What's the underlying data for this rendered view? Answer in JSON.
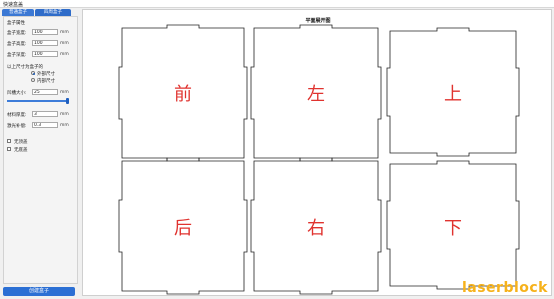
{
  "window": {
    "title": "快速盒盖"
  },
  "tabs": [
    {
      "label": "普通盒子"
    },
    {
      "label": "四周盒子"
    }
  ],
  "panel": {
    "section_title": "盒子属性",
    "width_label": "盒子宽度:",
    "width_value": "100",
    "height_label": "盒子高度:",
    "height_value": "100",
    "depth_label": "盒子深度:",
    "depth_value": "100",
    "unit": "mm",
    "size_mode_label": "以上尺寸为盒子的",
    "outer_size_label": "外部尺寸",
    "inner_size_label": "内部尺寸",
    "teeth_label": "凹槽大小:",
    "teeth_value": "25",
    "teeth_unit": "mm",
    "teeth_fraction": 0.97,
    "thickness_label": "材料厚度:",
    "thickness_value": "3",
    "kerf_label": "激光补偿:",
    "kerf_value": "0.3",
    "no_top_label": "无顶盖",
    "no_bottom_label": "无底盖",
    "create_button": "创建盒子"
  },
  "canvas": {
    "title": "平面展开图",
    "faces": [
      "前",
      "左",
      "上",
      "后",
      "右",
      "下"
    ]
  },
  "brand": "laserblock",
  "colors": {
    "accent": "#2b6fd4",
    "face_label": "#e0332f",
    "brand": "#f6b21b"
  }
}
